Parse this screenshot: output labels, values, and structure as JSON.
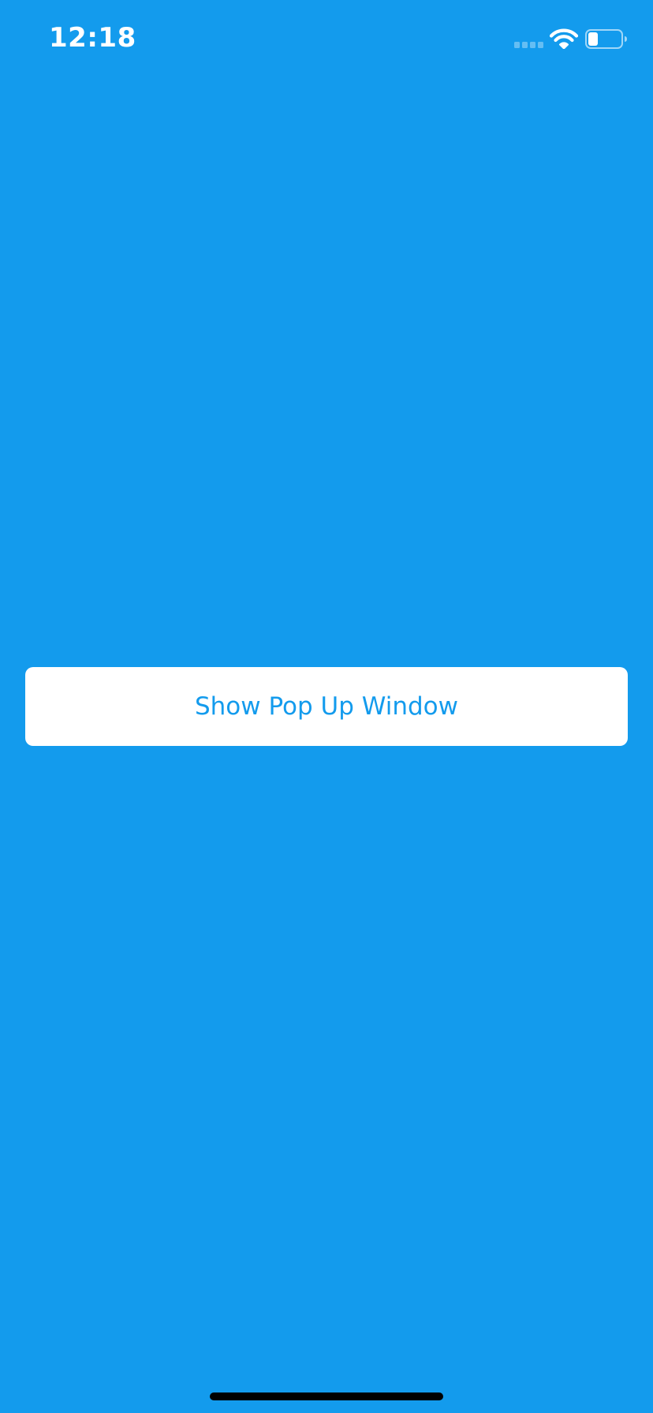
{
  "status_bar": {
    "time": "12:18",
    "signal_icon": "cellular-signal-icon",
    "wifi_icon": "wifi-icon",
    "battery_icon": "battery-icon",
    "battery_level": 0.3
  },
  "main": {
    "button_label": "Show Pop Up Window"
  },
  "colors": {
    "background": "#139bed",
    "button_background": "#ffffff",
    "button_text": "#139bed",
    "home_indicator": "#000000"
  }
}
